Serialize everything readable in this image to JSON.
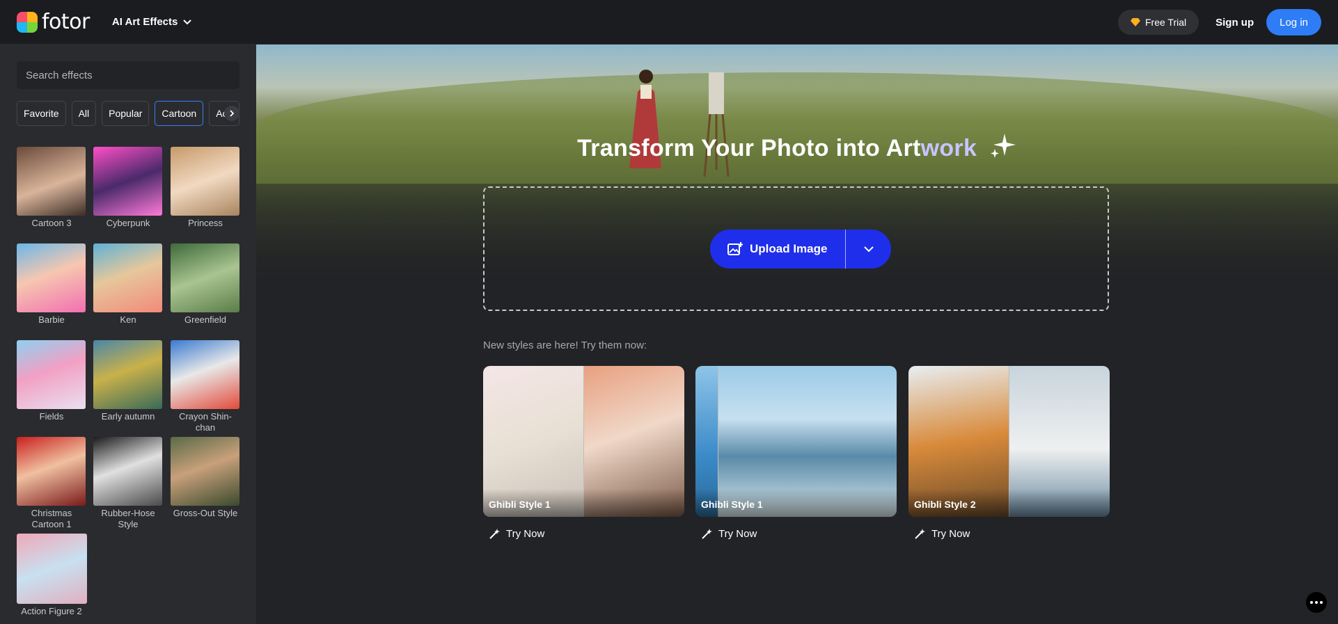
{
  "header": {
    "brand": "fotor",
    "menu_label": "AI Art Effects",
    "free_trial": "Free Trial",
    "signup": "Sign up",
    "login": "Log in"
  },
  "sidebar": {
    "search_placeholder": "Search effects",
    "chips": [
      {
        "label": "Favorite",
        "active": false
      },
      {
        "label": "All",
        "active": false
      },
      {
        "label": "Popular",
        "active": false
      },
      {
        "label": "Cartoon",
        "active": true
      },
      {
        "label": "Acti",
        "active": false
      }
    ],
    "effects": [
      {
        "label": "Cartoon 3"
      },
      {
        "label": "Cyberpunk"
      },
      {
        "label": "Princess"
      },
      {
        "label": "Barbie"
      },
      {
        "label": "Ken"
      },
      {
        "label": "Greenfield"
      },
      {
        "label": "Fields"
      },
      {
        "label": "Early autumn"
      },
      {
        "label": "Crayon Shin-chan"
      },
      {
        "label": "Christmas Cartoon 1"
      },
      {
        "label": "Rubber-Hose Style"
      },
      {
        "label": "Gross-Out Style"
      },
      {
        "label": "Action Figure 2"
      }
    ]
  },
  "hero": {
    "title_prefix": "Transform Your Photo into Art",
    "title_highlight": "work",
    "upload_label": "Upload Image"
  },
  "styles": {
    "intro": "New styles are here! Try them now:",
    "cards": [
      {
        "name": "Ghibli Style 1",
        "cta": "Try Now"
      },
      {
        "name": "Ghibli Style 1",
        "cta": "Try Now"
      },
      {
        "name": "Ghibli Style 2",
        "cta": "Try Now"
      }
    ]
  },
  "colors": {
    "accent_blue": "#2e7cf6",
    "upload_blue": "#1f2eea",
    "title_highlight": "#c8c3ff"
  }
}
